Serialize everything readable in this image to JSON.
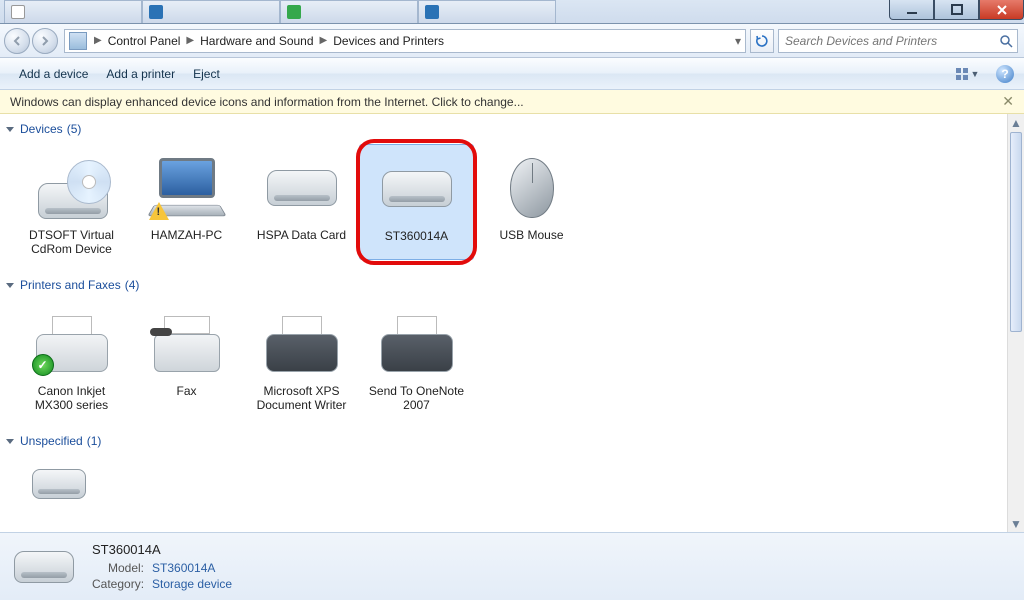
{
  "window": {
    "tabs": [
      {
        "label": ""
      },
      {
        "label": ""
      },
      {
        "label": ""
      },
      {
        "label": ""
      }
    ],
    "min": "–",
    "max": "▢",
    "close": "✕"
  },
  "breadcrumbs": [
    "Control Panel",
    "Hardware and Sound",
    "Devices and Printers"
  ],
  "search": {
    "placeholder": "Search Devices and Printers"
  },
  "commands": {
    "add_device": "Add a device",
    "add_printer": "Add a printer",
    "eject": "Eject"
  },
  "infobar": {
    "text": "Windows can display enhanced device icons and information from the Internet. Click to change...",
    "close": "✕"
  },
  "sections": {
    "devices": {
      "title": "Devices",
      "count": 5,
      "items": [
        {
          "label": "DTSOFT Virtual CdRom Device",
          "icon": "cd-drive"
        },
        {
          "label": "HAMZAH-PC",
          "icon": "laptop-warn"
        },
        {
          "label": "HSPA Data Card",
          "icon": "drive-blue"
        },
        {
          "label": "ST360014A",
          "icon": "drive-green",
          "selected": true,
          "highlighted": true
        },
        {
          "label": "USB Mouse",
          "icon": "mouse"
        }
      ]
    },
    "printers": {
      "title": "Printers and Faxes",
      "count": 4,
      "items": [
        {
          "label": "Canon Inkjet MX300 series",
          "icon": "printer-ok"
        },
        {
          "label": "Fax",
          "icon": "fax"
        },
        {
          "label": "Microsoft XPS Document Writer",
          "icon": "printer-dark"
        },
        {
          "label": "Send To OneNote 2007",
          "icon": "printer-dark"
        }
      ]
    },
    "unspecified": {
      "title": "Unspecified",
      "count": 1,
      "items": [
        {
          "label": "",
          "icon": "small-drive"
        }
      ]
    }
  },
  "details": {
    "name": "ST360014A",
    "model_key": "Model:",
    "model_val": "ST360014A",
    "cat_key": "Category:",
    "cat_val": "Storage device"
  }
}
